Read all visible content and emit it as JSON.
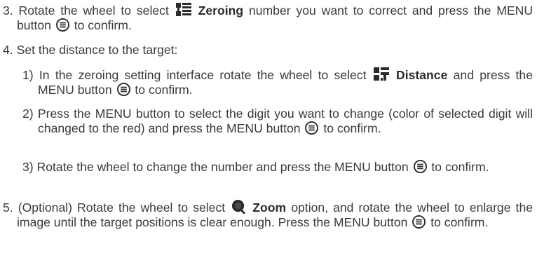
{
  "step3": {
    "number": "3.",
    "text_before": "Rotate the wheel to select",
    "zeroing": "Zeroing",
    "text_after": "number you want to correct and press the MENU button",
    "text_end": "to confirm."
  },
  "step4": {
    "number": "4.",
    "text": "Set the distance to the target:",
    "sub1": {
      "number": "1)",
      "text_before": "In the zeroing setting interface rotate the wheel to select",
      "distance": "Distance",
      "text_after": "and press the MENU button",
      "text_end": "to confirm."
    },
    "sub2": {
      "number": "2)",
      "text_before": "Press the MENU button to select the digit you want to change (color of selected digit will changed to the red) and press the MENU button",
      "text_end": "to confirm."
    },
    "sub3": {
      "number": "3)",
      "text_before": "Rotate the wheel to change the number and press the MENU button",
      "text_end": "to confirm."
    }
  },
  "step5": {
    "number": "5.",
    "text_before": "(Optional) Rotate the wheel to select",
    "zoom": "Zoom",
    "text_after": "option, and rotate the wheel to enlarge the image until the target positions is clear enough. Press the MENU button",
    "text_end": "to confirm."
  },
  "icons": {
    "zeroing": "zeroing-icon",
    "distance": "distance-icon",
    "menu": "menu-button-icon",
    "zoom": "zoom-icon"
  },
  "colors": {
    "text": "#3a3a3a",
    "icon": "#2b2b2b",
    "icon_accent": "#4a4a4a"
  }
}
